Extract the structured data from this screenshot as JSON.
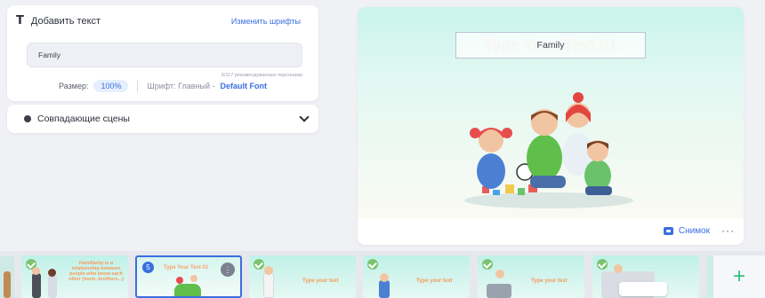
{
  "text_panel": {
    "title": "Добавить текст",
    "change_fonts": "Изменить шрифты",
    "input_value": "Family",
    "counter": "6/117 рекомендованные персонажи",
    "size_label": "Размер:",
    "size_value": "100%",
    "font_label": "Шрифт: Главный -",
    "font_value": "Default Font"
  },
  "matching_scenes": {
    "label": "Совпадающие сцены"
  },
  "preview": {
    "title_text": "Family",
    "ghost_title": "Type Your Text 01",
    "snapshot_label": "Снимок",
    "more_label": "···"
  },
  "timeline": {
    "scenes": [
      {
        "text": "Familiarity is a relationship between people who know each other (mom, brothers...)"
      },
      {
        "number": "5",
        "text": "Type Your Text 01",
        "menu": "⋮"
      },
      {
        "text": "Type your text"
      },
      {
        "text": "Type your text"
      },
      {
        "text": "Type your text"
      },
      {
        "text": ""
      }
    ],
    "add_label": "+"
  },
  "colors": {
    "accent": "#3a6fe0",
    "check": "#7cc36f",
    "plus": "#2ec27e",
    "scene_text": "#f59a5c"
  }
}
